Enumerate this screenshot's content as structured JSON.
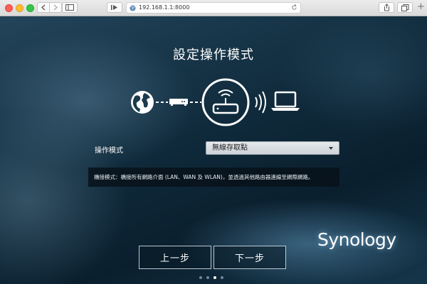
{
  "browser": {
    "url": "192.168.1.1:8000",
    "new_tab": "+"
  },
  "page": {
    "title": "設定操作模式",
    "mode_label": "操作模式",
    "mode_value": "無線存取點",
    "description": "橋接模式：橋接所有網路介面 (LAN、WAN 及 WLAN)，並透過其他路由器連線至網際網路。",
    "logo": "Synology",
    "prev_button": "上一步",
    "next_button": "下一步"
  },
  "pagination": {
    "total": 4,
    "current_index": 2
  }
}
